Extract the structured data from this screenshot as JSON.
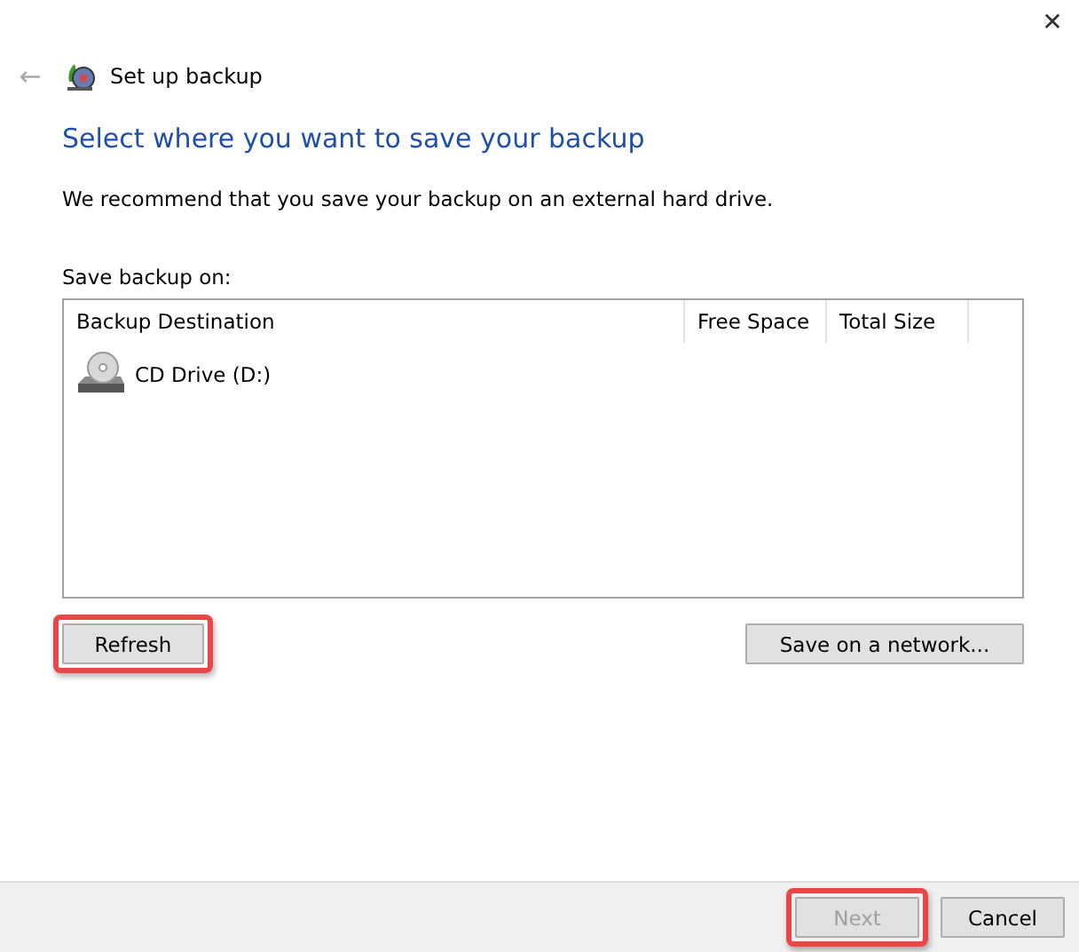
{
  "window": {
    "close": "✕",
    "back": "←",
    "title": "Set up backup"
  },
  "heading": "Select where you want to save your backup",
  "intro": "We recommend that you save your backup on an external hard drive.",
  "list_label": "Save backup on:",
  "table": {
    "columns": [
      "Backup Destination",
      "Free Space",
      "Total Size"
    ],
    "rows": [
      {
        "kind": "cd",
        "cells": [
          "CD Drive (D:)",
          "",
          ""
        ],
        "selected": false
      }
    ]
  },
  "buttons": [
    {
      "label": "Refresh",
      "highlighted": true,
      "disabled": false
    },
    {
      "label": "Save on a network...",
      "highlighted": false,
      "disabled": false
    }
  ],
  "footer_buttons": [
    {
      "label": "Next",
      "highlighted": true,
      "disabled": true
    },
    {
      "label": "Cancel",
      "highlighted": false,
      "disabled": false
    }
  ]
}
